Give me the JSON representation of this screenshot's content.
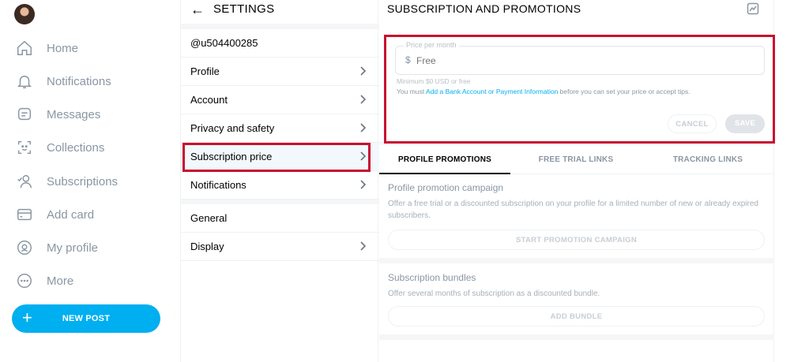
{
  "nav": {
    "items": [
      {
        "label": "Home",
        "icon": "home-icon"
      },
      {
        "label": "Notifications",
        "icon": "bell-icon"
      },
      {
        "label": "Messages",
        "icon": "message-icon"
      },
      {
        "label": "Collections",
        "icon": "collections-icon"
      },
      {
        "label": "Subscriptions",
        "icon": "subscriptions-icon"
      },
      {
        "label": "Add card",
        "icon": "card-icon"
      },
      {
        "label": "My profile",
        "icon": "profile-icon"
      },
      {
        "label": "More",
        "icon": "more-icon"
      }
    ],
    "new_post_label": "NEW POST",
    "accent": "#00aff0"
  },
  "settings": {
    "title": "SETTINGS",
    "username": "@u504400285",
    "items": [
      {
        "label": "Profile"
      },
      {
        "label": "Account"
      },
      {
        "label": "Privacy and safety"
      },
      {
        "label": "Subscription price"
      },
      {
        "label": "Notifications"
      }
    ],
    "general_heading": "General",
    "display_label": "Display"
  },
  "panel": {
    "title": "SUBSCRIPTION AND PROMOTIONS",
    "price": {
      "legend": "Price per month",
      "currency": "$",
      "placeholder": "Free",
      "hint": "Minimum $0 USD or free",
      "note_prefix": "You must ",
      "note_link": "Add a Bank Account or Payment Information",
      "note_suffix": " before you can set your price or accept tips."
    },
    "cancel_label": "CANCEL",
    "save_label": "SAVE",
    "tabs": [
      {
        "label": "PROFILE PROMOTIONS",
        "active": true
      },
      {
        "label": "FREE TRIAL LINKS",
        "active": false
      },
      {
        "label": "TRACKING LINKS",
        "active": false
      }
    ],
    "promotion": {
      "title": "Profile promotion campaign",
      "desc": "Offer a free trial or a discounted subscription on your profile for a limited number of new or already expired subscribers.",
      "button": "START PROMOTION CAMPAIGN"
    },
    "bundles": {
      "title": "Subscription bundles",
      "desc": "Offer several months of subscription as a discounted bundle.",
      "button": "ADD BUNDLE"
    }
  },
  "colors": {
    "highlight": "#c8102e",
    "muted_text": "#8a96a3"
  }
}
